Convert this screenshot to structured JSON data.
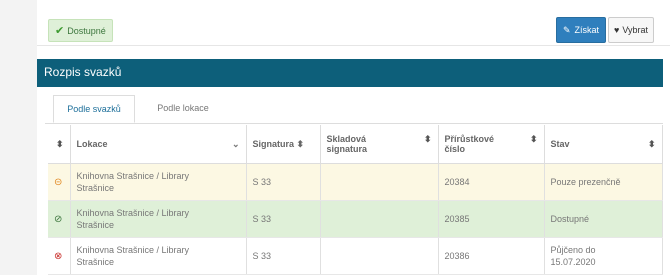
{
  "badge": {
    "label": "Dostupné",
    "icon": "check-icon"
  },
  "buttons": {
    "ziskat": "Získat",
    "vybrat": "Vybrat"
  },
  "section_title": "Rozpis svazků",
  "tabs": [
    "Podle svazků",
    "Podle lokace"
  ],
  "columns": {
    "c1": "Lokace",
    "c2": "Signatura",
    "c3a": "Skladová",
    "c3b": "signatura",
    "c4a": "Přírůstkové",
    "c4b": "číslo",
    "c5": "Stav"
  },
  "rows": [
    {
      "status_icon": "circle-minus-icon",
      "status_color": "#e0861d",
      "loc1": "Knihovna Strašnice / Library",
      "loc2": "Strašnice",
      "sig": "S 33",
      "sklad": "",
      "prir": "20384",
      "stav1": "Pouze prezenčně",
      "stav2": ""
    },
    {
      "status_icon": "circle-check-icon",
      "status_color": "#3c763d",
      "loc1": "Knihovna Strašnice / Library",
      "loc2": "Strašnice",
      "sig": "S 33",
      "sklad": "",
      "prir": "20385",
      "stav1": "Dostupné",
      "stav2": ""
    },
    {
      "status_icon": "circle-x-icon",
      "status_color": "#c9302c",
      "loc1": "Knihovna Strašnice / Library",
      "loc2": "Strašnice",
      "sig": "S 33",
      "sklad": "",
      "prir": "20386",
      "stav1": "Půjčeno do",
      "stav2": "15.07.2020"
    }
  ]
}
